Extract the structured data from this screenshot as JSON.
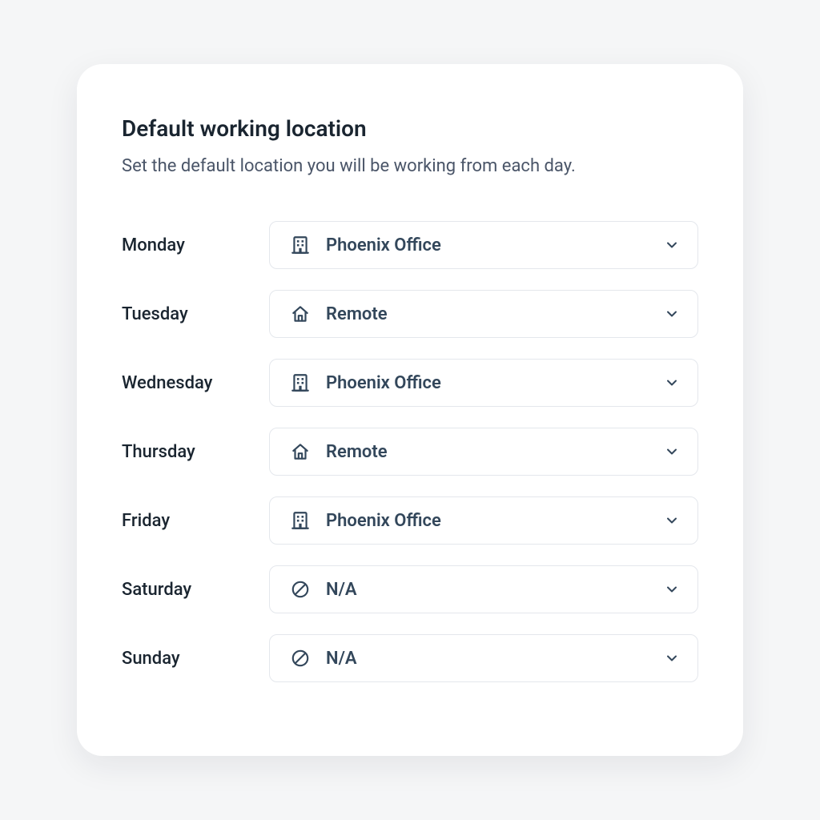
{
  "header": {
    "title": "Default working location",
    "subtitle": "Set the default location you will be working from each day."
  },
  "icons": {
    "office": "building-icon",
    "remote": "home-icon",
    "na": "not-available-icon"
  },
  "days": [
    {
      "label": "Monday",
      "icon": "office",
      "value": "Phoenix Office"
    },
    {
      "label": "Tuesday",
      "icon": "remote",
      "value": "Remote"
    },
    {
      "label": "Wednesday",
      "icon": "office",
      "value": "Phoenix Office"
    },
    {
      "label": "Thursday",
      "icon": "remote",
      "value": "Remote"
    },
    {
      "label": "Friday",
      "icon": "office",
      "value": "Phoenix Office"
    },
    {
      "label": "Saturday",
      "icon": "na",
      "value": "N/A"
    },
    {
      "label": "Sunday",
      "icon": "na",
      "value": "N/A"
    }
  ]
}
